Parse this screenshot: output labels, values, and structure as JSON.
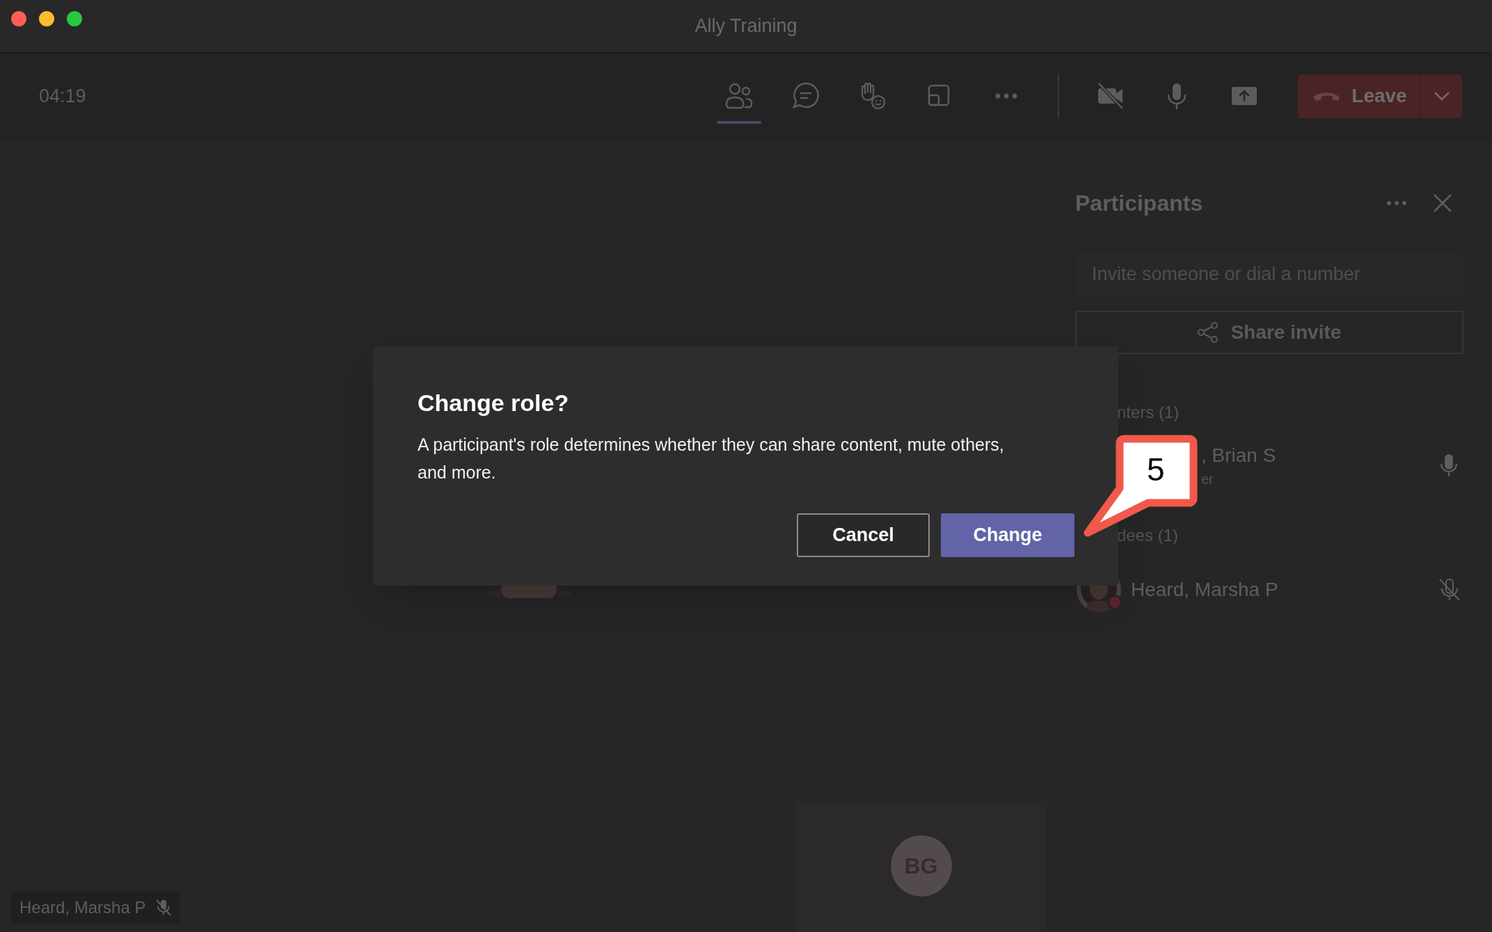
{
  "window": {
    "title": "Ally Training"
  },
  "toolbar": {
    "timer": "04:19",
    "buttons": [
      {
        "kind": "people",
        "selected": true
      },
      {
        "kind": "chat",
        "selected": false
      },
      {
        "kind": "raise-hand",
        "selected": false
      },
      {
        "kind": "rooms",
        "selected": false
      },
      {
        "kind": "more",
        "selected": false
      },
      {
        "kind": "divider",
        "selected": false
      },
      {
        "kind": "camera-off",
        "selected": false
      },
      {
        "kind": "mic",
        "selected": false
      },
      {
        "kind": "share",
        "selected": false
      }
    ],
    "leave": {
      "label": "Leave"
    }
  },
  "stage": {
    "tile_label": "Heard, Marsha P",
    "tile_muted": true,
    "bg_tile": {
      "initials": "BG"
    }
  },
  "participants_panel": {
    "title": "Participants",
    "search": {
      "placeholder": "Invite someone or dial a number"
    },
    "share_button": "Share invite",
    "sections": [
      {
        "heading": "nters (1)",
        "people": [
          {
            "name": ", Brian S",
            "role": "er",
            "muted": false,
            "busy": false
          }
        ]
      },
      {
        "heading": "dees (1)",
        "people": [
          {
            "name": "Heard, Marsha P",
            "muted": true,
            "busy": true
          }
        ]
      }
    ]
  },
  "dialog": {
    "title": "Change role?",
    "body": "A participant's role determines whether they can share content, mute others, and more.",
    "buttons": [
      {
        "label": "Cancel",
        "kind": "secondary"
      },
      {
        "label": "Change",
        "kind": "primary"
      }
    ]
  },
  "callout": {
    "number": "5"
  }
}
